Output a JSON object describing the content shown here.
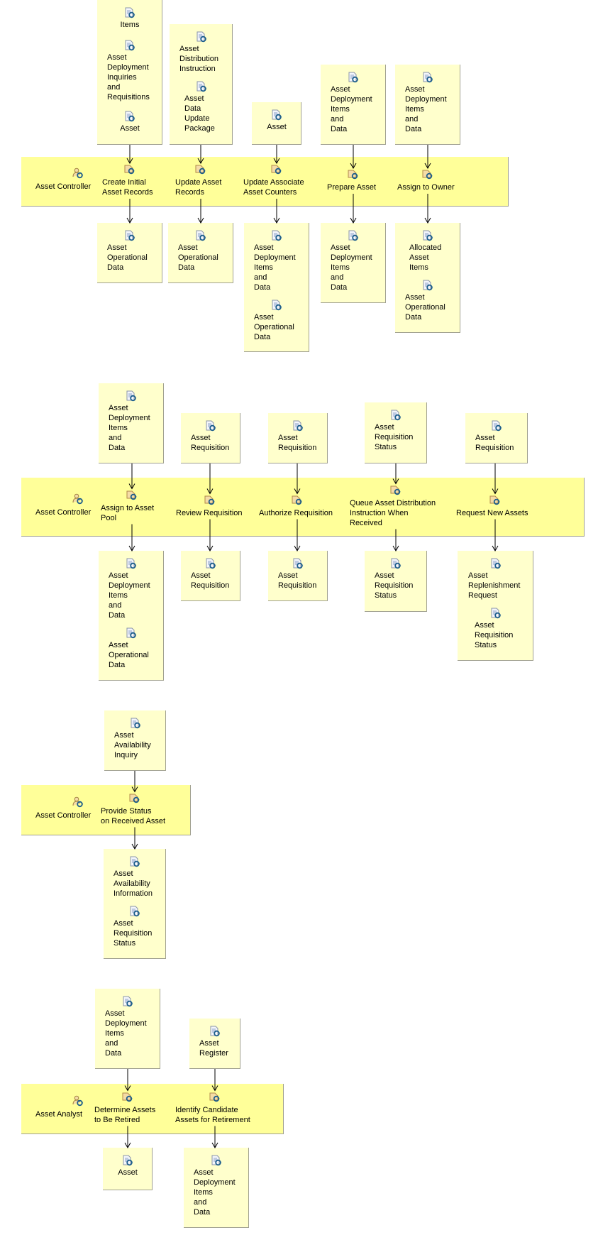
{
  "diagrams": [
    {
      "role": "Asset Controller",
      "tasks": [
        {
          "label": "Create Initial\nAsset Records",
          "inputs": [
            "Items",
            "Asset\nDeployment\nInquiries\nand\nRequisitions",
            "Asset"
          ],
          "outputs": [
            "Asset\nOperational\nData"
          ]
        },
        {
          "label": "Update Asset\nRecords",
          "inputs": [
            "Asset\nDistribution\nInstruction",
            "Asset\nData\nUpdate\nPackage"
          ],
          "outputs": [
            "Asset\nOperational\nData"
          ]
        },
        {
          "label": "Update Associate\nAsset Counters",
          "inputs": [
            "Asset"
          ],
          "outputs": [
            "Asset\nDeployment\nItems\nand\nData",
            "Asset\nOperational\nData"
          ]
        },
        {
          "label": "Prepare Asset",
          "inputs": [
            "Asset\nDeployment\nItems\nand\nData"
          ],
          "outputs": [
            "Asset\nDeployment\nItems\nand\nData"
          ]
        },
        {
          "label": "Assign to Owner",
          "inputs": [
            "Asset\nDeployment\nItems\nand\nData"
          ],
          "outputs": [
            "Allocated\nAsset\nItems",
            "Asset\nOperational\nData"
          ]
        }
      ]
    },
    {
      "role": "Asset Controller",
      "tasks": [
        {
          "label": "Assign to Asset\nPool",
          "inputs": [
            "Asset\nDeployment\nItems\nand\nData"
          ],
          "outputs": [
            "Asset\nDeployment\nItems\nand\nData",
            "Asset\nOperational\nData"
          ]
        },
        {
          "label": "Review Requisition",
          "inputs": [
            "Asset\nRequisition"
          ],
          "outputs": [
            "Asset\nRequisition"
          ]
        },
        {
          "label": "Authorize Requisition",
          "inputs": [
            "Asset\nRequisition"
          ],
          "outputs": [
            "Asset\nRequisition"
          ]
        },
        {
          "label": "Queue Asset Distribution\nInstruction When\nReceived",
          "inputs": [
            "Asset\nRequisition\nStatus"
          ],
          "outputs": [
            "Asset\nRequisition\nStatus"
          ]
        },
        {
          "label": "Request New Assets",
          "inputs": [
            "Asset\nRequisition"
          ],
          "outputs": [
            "Asset\nReplenishment\nRequest",
            "Asset\nRequisition\nStatus"
          ]
        }
      ]
    },
    {
      "role": "Asset Controller",
      "tasks": [
        {
          "label": "Provide Status\non Received Asset",
          "inputs": [
            "Asset\nAvailability\nInquiry"
          ],
          "outputs": [
            "Asset\nAvailability\nInformation",
            "Asset\nRequisition\nStatus"
          ]
        }
      ]
    },
    {
      "role": "Asset Analyst",
      "tasks": [
        {
          "label": "Determine Assets\nto Be Retired",
          "inputs": [
            "Asset\nDeployment\nItems\nand\nData"
          ],
          "outputs": [
            "Asset"
          ]
        },
        {
          "label": "Identify Candidate\nAssets for Retirement",
          "inputs": [
            "Asset\nRegister"
          ],
          "outputs": [
            "Asset\nDeployment\nItems\nand\nData"
          ]
        }
      ]
    }
  ],
  "icons": {
    "role": "role-icon",
    "task": "task-icon",
    "artifact": "artifact-icon"
  },
  "colors": {
    "lane": "#ffff99",
    "box": "#ffffcc",
    "border": "#a0a090",
    "icon_blue": "#1b5d8c"
  }
}
